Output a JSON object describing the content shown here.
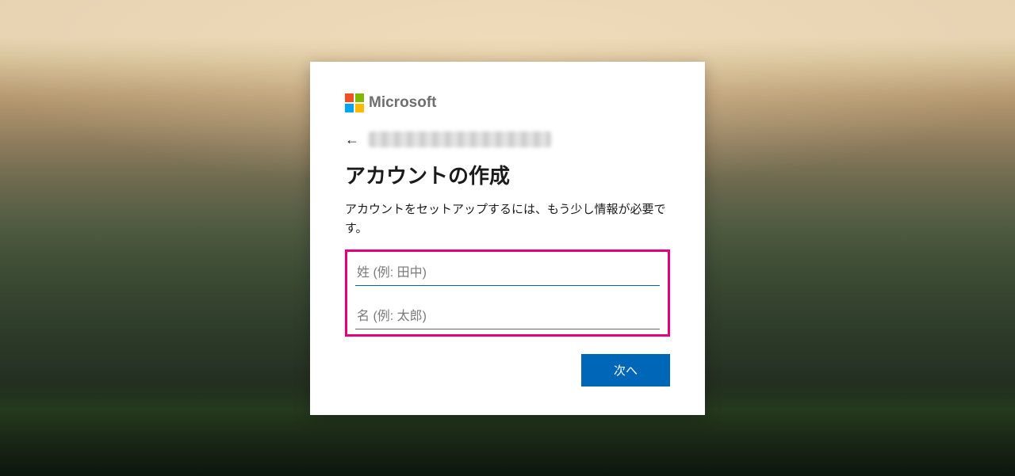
{
  "brand": {
    "name": "Microsoft"
  },
  "header": {
    "back_aria": "戻る",
    "identity_obscured": true
  },
  "main": {
    "title": "アカウントの作成",
    "description": "アカウントをセットアップするには、もう少し情報が必要です。",
    "fields": {
      "surname_placeholder": "姓 (例: 田中)",
      "given_placeholder": "名 (例: 太郎)",
      "surname_value": "",
      "given_value": ""
    },
    "next_label": "次へ"
  },
  "colors": {
    "accent": "#0067b8",
    "highlight": "#e6007e"
  }
}
